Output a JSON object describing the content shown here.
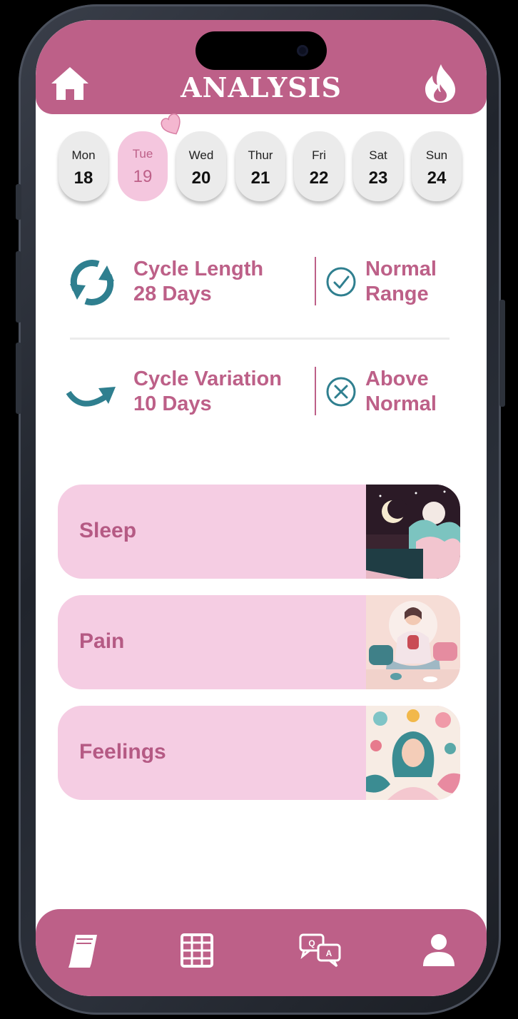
{
  "header": {
    "title": "ANALYSIS"
  },
  "week": [
    {
      "day": "Mon",
      "date": "18"
    },
    {
      "day": "Tue",
      "date": "19"
    },
    {
      "day": "Wed",
      "date": "20"
    },
    {
      "day": "Thur",
      "date": "21"
    },
    {
      "day": "Fri",
      "date": "22"
    },
    {
      "day": "Sat",
      "date": "23"
    },
    {
      "day": "Sun",
      "date": "24"
    }
  ],
  "selected_day": "Tue",
  "stats": [
    {
      "line1": "Cycle Length",
      "line2": "28 Days",
      "status_line1": "Normal",
      "status_line2": "Range",
      "status_icon": "check-circle-icon",
      "icon": "cycle-refresh-icon"
    },
    {
      "line1": "Cycle Variation",
      "line2": "10 Days",
      "status_line1": "Above",
      "status_line2": "Normal",
      "status_icon": "x-circle-icon",
      "icon": "curved-arrow-icon"
    }
  ],
  "cards": [
    {
      "label": "Sleep",
      "image": "sleep-illustration"
    },
    {
      "label": "Pain",
      "image": "pain-illustration"
    },
    {
      "label": "Feelings",
      "image": "feelings-illustration"
    }
  ],
  "bottom_nav": [
    "book-icon",
    "calendar-grid-icon",
    "qa-chat-icon",
    "profile-icon"
  ],
  "colors": {
    "brand": "#bd6088",
    "accent_pink": "#f5cde3",
    "teal": "#2f7f8f",
    "day_bg": "#ebebeb"
  }
}
